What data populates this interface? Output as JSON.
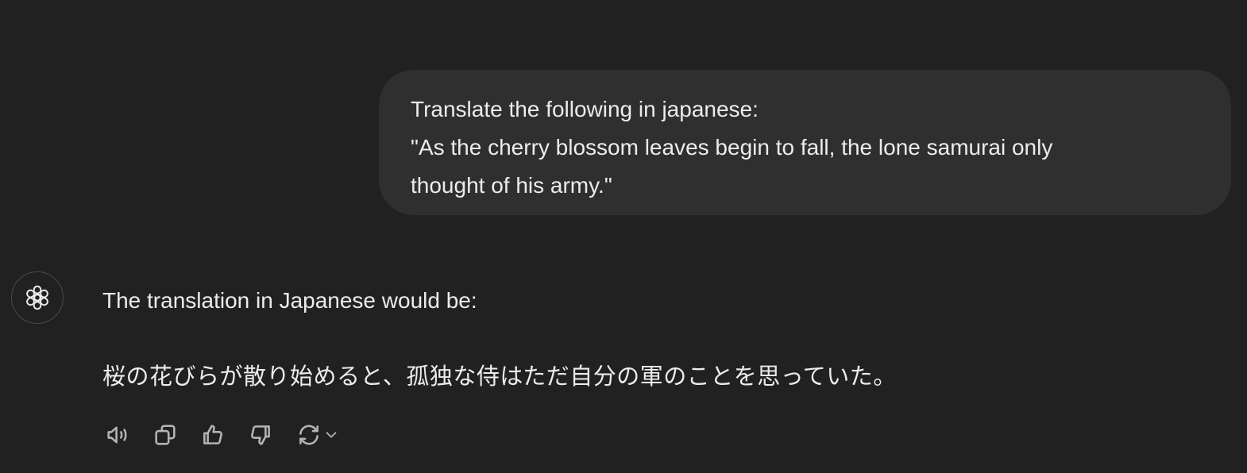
{
  "user_message": {
    "lines": [
      "Translate the following in japanese:",
      "\"As the cherry blossom leaves begin to fall, the lone samurai only",
      "thought of his army.\""
    ]
  },
  "assistant_message": {
    "avatar_icon": "openai-logo-icon",
    "intro": "The translation in Japanese would be:",
    "translation": "桜の花びらが散り始めると、孤独な侍はただ自分の軍のことを思っていた。"
  },
  "actions": [
    {
      "icon": "speaker-icon",
      "label": "Read aloud"
    },
    {
      "icon": "copy-icon",
      "label": "Copy"
    },
    {
      "icon": "thumbs-up-icon",
      "label": "Good response"
    },
    {
      "icon": "thumbs-down-icon",
      "label": "Bad response"
    },
    {
      "icon": "regenerate-icon",
      "label": "Regenerate"
    }
  ],
  "colors": {
    "background": "#212121",
    "user_bubble": "#2f2f2f",
    "text": "#ececec",
    "icon": "#b4b4b4"
  }
}
